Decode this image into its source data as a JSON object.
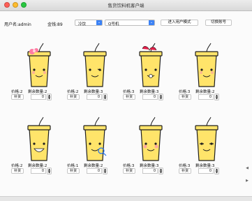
{
  "window": {
    "title": "售货饮料机客户端"
  },
  "toolbar": {
    "username_label": "用户名:admin",
    "balance_label": "金钱:89",
    "temp_select": "冷饮",
    "machine_select": "Q号机",
    "user_mode_button": "进入用户模式",
    "switch_account_button": "切换账号"
  },
  "colors": {
    "cup": "#ffe46a",
    "cup_outline": "#1e1e1e",
    "accent": "#3b82f6"
  },
  "products": [
    {
      "price": "价格:2",
      "stock": "剩余数量:2",
      "buy": "补货",
      "qty": "0",
      "face": "girl-bow"
    },
    {
      "price": "价格:2",
      "stock": "剩余数量:3",
      "buy": "补货",
      "qty": "0",
      "face": "wink"
    },
    {
      "price": "价格:3",
      "stock": "剩余数量:3",
      "buy": "补货",
      "qty": "0",
      "face": "surprised-red-hair"
    },
    {
      "price": "价格:3",
      "stock": "剩余数量:2",
      "buy": "补货",
      "qty": "0",
      "face": "smile"
    },
    {
      "price": "价格:2",
      "stock": "剩余数量:2",
      "buy": "补货",
      "qty": "0",
      "face": "grin-teeth"
    },
    {
      "price": "价格:1",
      "stock": "剩余数量:2",
      "buy": "补货",
      "qty": "0",
      "face": "magnifier"
    },
    {
      "price": "价格:3",
      "stock": "剩余数量:3",
      "buy": "补货",
      "qty": "0",
      "face": "blush"
    },
    {
      "price": "价格:3",
      "stock": "剩余数量:3",
      "buy": "补货",
      "qty": "0",
      "face": "closed-eyes"
    }
  ],
  "scroll": {
    "up": "◀",
    "down": "▶"
  }
}
